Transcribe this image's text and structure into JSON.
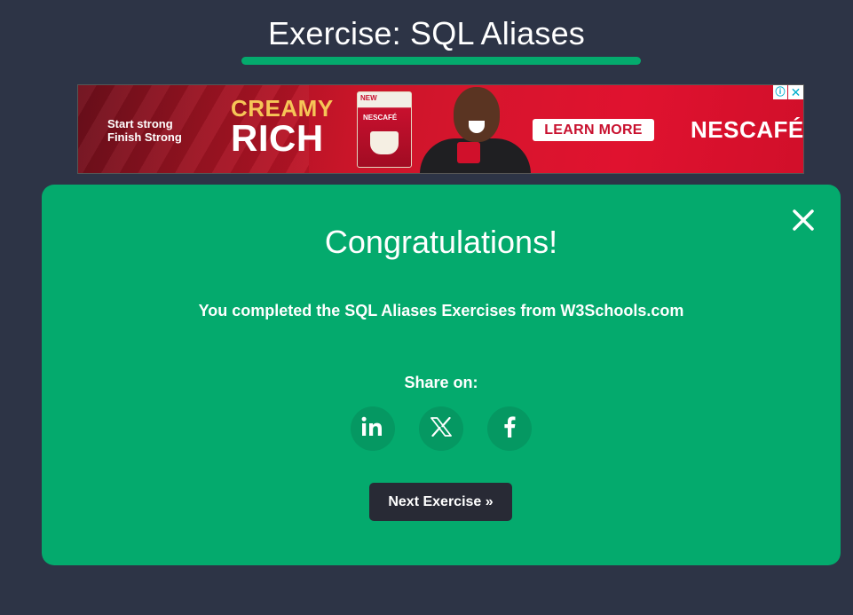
{
  "header": {
    "title": "Exercise: SQL Aliases"
  },
  "ad": {
    "tagline_line1": "Start strong",
    "tagline_line2": "Finish Strong",
    "headline_top": "CREAMY",
    "headline_bottom": "RICH",
    "pack_new": "NEW",
    "pack_brand": "NESCAFÉ",
    "cta_label": "LEARN MORE",
    "brand": "NESCAFÉ",
    "info_icon": "info-icon",
    "close_icon": "close-icon",
    "info_glyph": "ⓘ",
    "close_glyph": "✕",
    "colors": {
      "background": "#d7152d",
      "cta_text": "#c8102e",
      "gold": "#f6c557"
    }
  },
  "modal": {
    "heading": "Congratulations!",
    "message": "You completed the SQL Aliases Exercises from W3Schools.com",
    "share_label": "Share on:",
    "share_buttons": [
      {
        "network": "LinkedIn",
        "icon": "linkedin-icon"
      },
      {
        "network": "X",
        "icon": "x-icon"
      },
      {
        "network": "Facebook",
        "icon": "facebook-icon"
      }
    ],
    "next_button_label": "Next Exercise »",
    "close_icon": "close-icon",
    "colors": {
      "background": "#04aa6d",
      "share_circle": "#059862",
      "next_button": "#282a35"
    }
  },
  "page": {
    "colors": {
      "background": "#2d3446",
      "accent": "#04aa6d"
    }
  }
}
